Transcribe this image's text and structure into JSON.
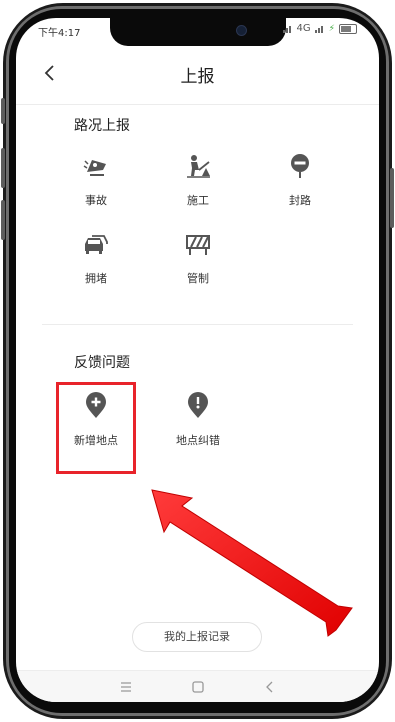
{
  "status_bar": {
    "time": "下午4:17",
    "network": "4G"
  },
  "header": {
    "title": "上报"
  },
  "road_section": {
    "title": "路况上报",
    "items": [
      {
        "label": "事故",
        "icon": "accident-icon"
      },
      {
        "label": "施工",
        "icon": "construction-icon"
      },
      {
        "label": "封路",
        "icon": "road-closed-icon"
      },
      {
        "label": "拥堵",
        "icon": "congestion-icon"
      },
      {
        "label": "管制",
        "icon": "control-icon"
      }
    ]
  },
  "feedback_section": {
    "title": "反馈问题",
    "items": [
      {
        "label": "新增地点",
        "icon": "add-location-icon"
      },
      {
        "label": "地点纠错",
        "icon": "location-error-icon"
      }
    ]
  },
  "record_button": {
    "label": "我的上报记录"
  },
  "annotation": {
    "highlight_color": "#e8232a",
    "arrow_color": "#ff1a1a"
  }
}
